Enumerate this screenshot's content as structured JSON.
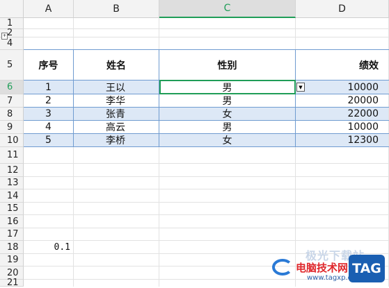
{
  "columns": [
    "A",
    "B",
    "C",
    "D"
  ],
  "rows": [
    "1",
    "2",
    "4",
    "5",
    "6",
    "7",
    "8",
    "9",
    "10",
    "11",
    "12",
    "13",
    "14",
    "15",
    "16",
    "17",
    "18",
    "19",
    "20",
    "21"
  ],
  "table": {
    "headers": [
      "序号",
      "姓名",
      "性别",
      "绩效"
    ],
    "records": [
      [
        "1",
        "王以",
        "男",
        "10000"
      ],
      [
        "2",
        "李华",
        "男",
        "20000"
      ],
      [
        "3",
        "张青",
        "女",
        "22000"
      ],
      [
        "4",
        "高云",
        "男",
        "10000"
      ],
      [
        "5",
        "李桥",
        "女",
        "12300"
      ]
    ]
  },
  "extra_cell": "0.1",
  "group_toggle": "+",
  "dropdown_arrow": "▼",
  "watermark": {
    "top_text": "极光下载站",
    "name": "电脑技术网",
    "url": "www.tagxp.com",
    "logo": "TAG"
  },
  "colors": {
    "accent": "#1f9d57",
    "band": "#dde8f6",
    "border_blue": "#6f9bd0"
  }
}
